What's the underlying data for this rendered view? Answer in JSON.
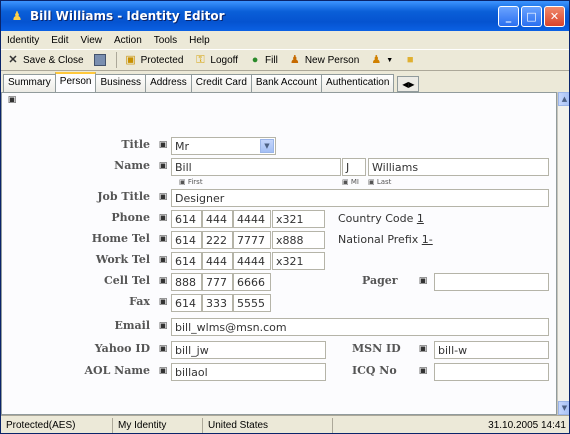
{
  "window": {
    "title": "Bill Williams - Identity Editor"
  },
  "menu": [
    "Identity",
    "Edit",
    "View",
    "Action",
    "Tools",
    "Help"
  ],
  "toolbar": {
    "save_close": "Save & Close",
    "protected": "Protected",
    "logoff": "Logoff",
    "fill": "Fill",
    "new_person": "New Person"
  },
  "tabs": [
    "Summary",
    "Person",
    "Business",
    "Address",
    "Credit Card",
    "Bank Account",
    "Authentication"
  ],
  "active_tab": "Person",
  "form": {
    "title": {
      "label": "Title",
      "value": "Mr"
    },
    "name": {
      "label": "Name",
      "first": "Bill",
      "mi": "J",
      "last": "Williams",
      "first_sub": "First",
      "mi_sub": "MI",
      "last_sub": "Last"
    },
    "job_title": {
      "label": "Job Title",
      "value": "Designer"
    },
    "phone": {
      "label": "Phone",
      "area": "614",
      "p1": "444",
      "p2": "4444",
      "ext": "321"
    },
    "home_tel": {
      "label": "Home Tel",
      "area": "614",
      "p1": "222",
      "p2": "7777",
      "ext": "888"
    },
    "work_tel": {
      "label": "Work Tel",
      "area": "614",
      "p1": "444",
      "p2": "4444",
      "ext": "321"
    },
    "cell_tel": {
      "label": "Cell Tel",
      "area": "888",
      "p1": "777",
      "p2": "6666"
    },
    "fax": {
      "label": "Fax",
      "area": "614",
      "p1": "333",
      "p2": "5555"
    },
    "email": {
      "label": "Email",
      "value": "bill_wlms@msn.com"
    },
    "yahoo": {
      "label": "Yahoo ID",
      "value": "bill_jw"
    },
    "aol": {
      "label": "AOL Name",
      "value": "billaol"
    },
    "msn": {
      "label": "MSN ID",
      "value": "bill-w"
    },
    "icq": {
      "label": "ICQ No",
      "value": ""
    },
    "pager": {
      "label": "Pager",
      "value": ""
    },
    "country_code": {
      "label": "Country Code",
      "value": "1"
    },
    "national_prefix": {
      "label": "National Prefix",
      "value": "1-"
    }
  },
  "status": {
    "protection": "Protected(AES)",
    "identity": "My Identity",
    "country": "United States",
    "datetime": "31.10.2005 14:41"
  }
}
